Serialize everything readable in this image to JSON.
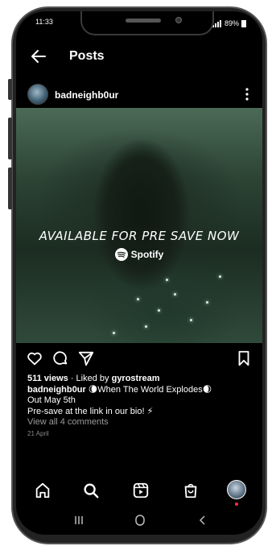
{
  "status_bar": {
    "time": "11:33",
    "right": "89%"
  },
  "header": {
    "title": "Posts"
  },
  "post": {
    "username": "badneighb0ur",
    "promo_text": "Available For Pre Save Now",
    "spotify_label": "Spotify",
    "views": "511 views",
    "liked_prefix": " · Liked by ",
    "liked_by": "gyrostream",
    "caption_user": "badneighb0ur",
    "caption_line1": "When The World Explodes",
    "caption_line2": "Out May 5th",
    "caption_line3": "Pre-save at the link in our bio! ⚡",
    "comments_link": "View all 4 comments",
    "date": "21 April"
  },
  "icons": {
    "back": "arrow-left-icon",
    "more": "more-vertical-icon",
    "like": "heart-icon",
    "comment": "comment-icon",
    "share": "send-icon",
    "save": "bookmark-icon",
    "home": "home-icon",
    "search": "search-icon",
    "reels": "reels-icon",
    "shop": "shop-icon"
  },
  "colors": {
    "background": "#000000",
    "notification_dot": "#ff3040",
    "muted_text": "#9a9a9a"
  }
}
